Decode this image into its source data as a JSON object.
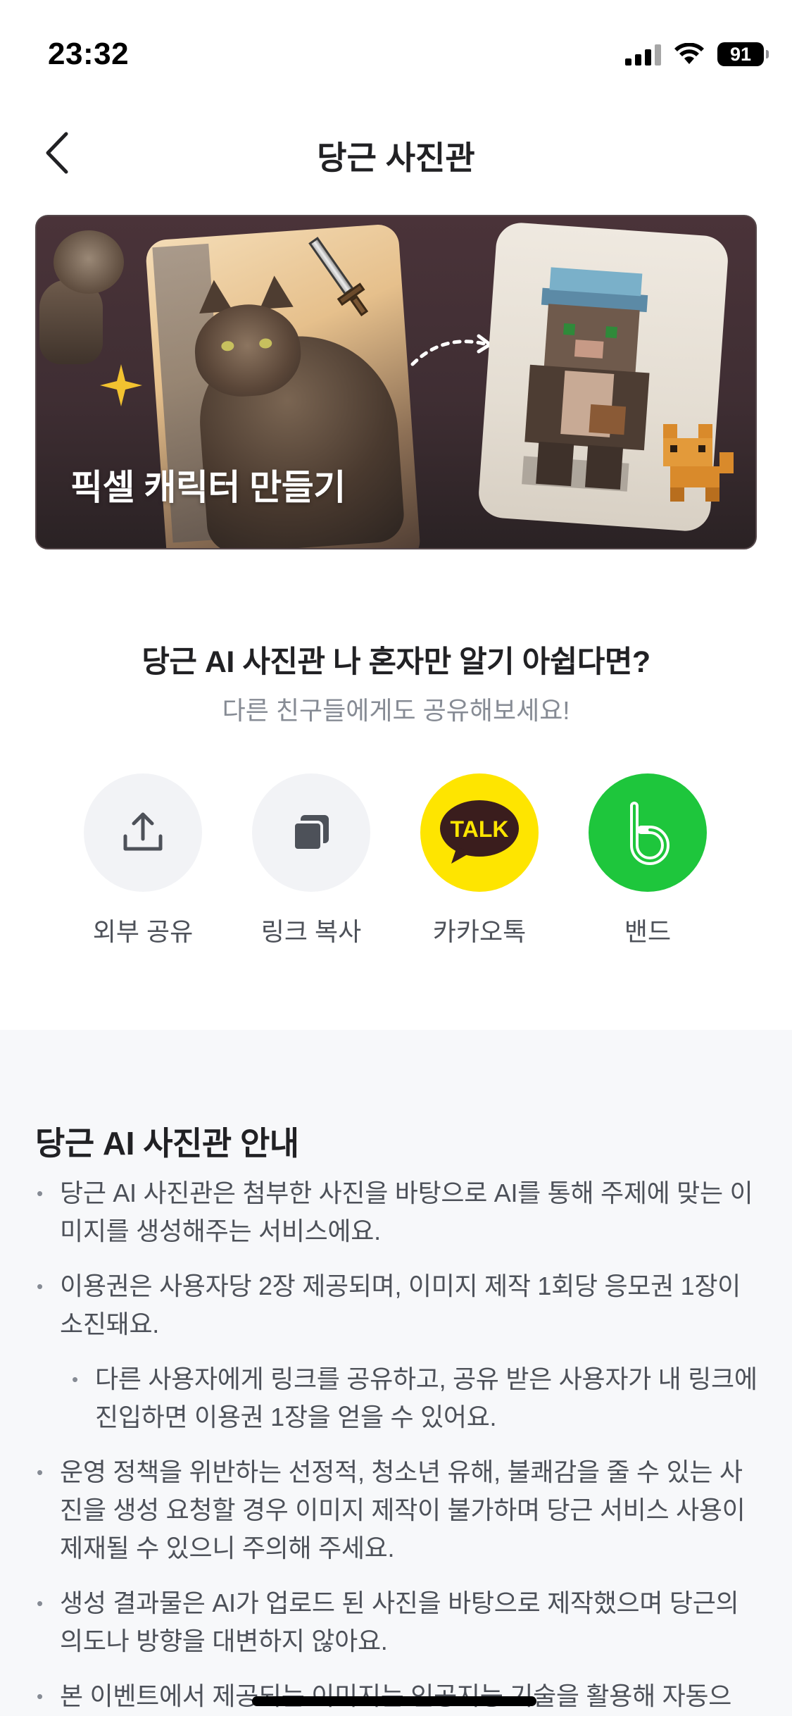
{
  "status_bar": {
    "time": "23:32",
    "battery": "91"
  },
  "header": {
    "title": "당근 사진관"
  },
  "banner": {
    "title": "픽셀 캐릭터 만들기"
  },
  "share": {
    "heading": "당근 AI 사진관 나 혼자만 알기 아쉽다면?",
    "subheading": "다른 친구들에게도 공유해보세요!",
    "options": [
      {
        "label": "외부 공유",
        "icon": "upload-icon"
      },
      {
        "label": "링크 복사",
        "icon": "copy-icon"
      },
      {
        "label": "카카오톡",
        "icon": "kakaotalk-icon",
        "icon_text": "TALK"
      },
      {
        "label": "밴드",
        "icon": "band-icon"
      }
    ]
  },
  "info": {
    "title": "당근 AI 사진관 안내",
    "items": [
      "당근 AI 사진관은 첨부한 사진을 바탕으로 AI를 통해 주제에 맞는 이미지를 생성해주는 서비스에요.",
      "이용권은 사용자당 2장 제공되며, 이미지 제작 1회당 응모권 1장이 소진돼요.",
      "다른 사용자에게 링크를 공유하고, 공유 받은 사용자가 내 링크에 진입하면 이용권 1장을 얻을 수 있어요.",
      "운영 정책을 위반하는 선정적, 청소년 유해, 불쾌감을 줄 수 있는 사진을 생성 요청할 경우 이미지 제작이 불가하며 당근 서비스 사용이 제재될 수 있으니 주의해 주세요.",
      "생성 결과물은 AI가 업로드 된 사진을 바탕으로 제작했으며 당근의 의도나 방향을 대변하지 않아요.",
      "본 이벤트에서 제공되는 이미지는 인공지능 기술을 활용해 자동으"
    ]
  },
  "colors": {
    "accent_orange": "#ff6f0f",
    "kakao_yellow": "#fee500",
    "band_green": "#1ec63c",
    "share_gray": "#f2f3f6",
    "text_secondary": "#868b94"
  }
}
